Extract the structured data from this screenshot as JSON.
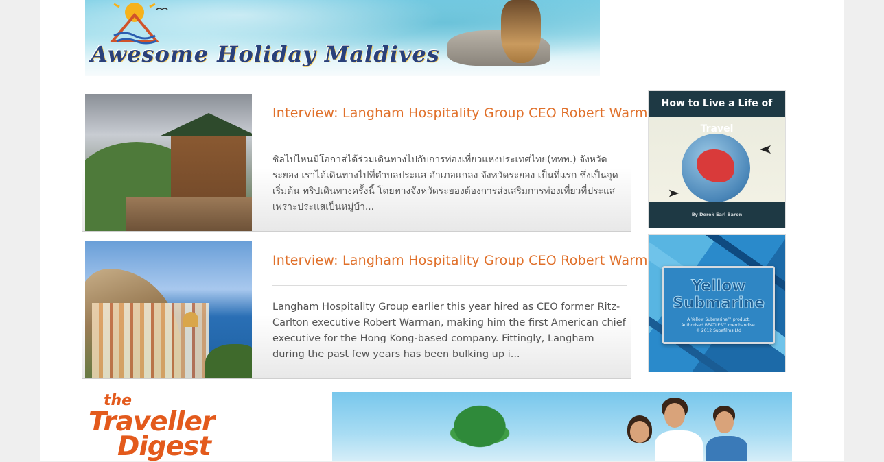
{
  "header": {
    "banner_text": "Awesome Holiday Maldives"
  },
  "articles": [
    {
      "title": "Interview: Langham Hospitality Group CEO Robert Warman",
      "excerpt": "ชิลไปไหนมีโอกาสได้ร่วมเดินทางไปกับการท่องเที่ยวแห่งประเทศไทย(ททท.) จังหวัดระยอง เราได้เดินทางไปที่ตำบลประแส อำเภอแกลง จังหวัดระยอง เป็นที่แรก ซึ่งเป็นจุดเริ่มต้น ทริปเดินทางครั้งนี้ โดยทางจังหวัดระยองต้องการส่งเสริมการท่องเที่ยวที่ประแส เพราะประแสเป็นหมู่บ้า..."
    },
    {
      "title": "Interview: Langham Hospitality Group CEO Robert Warman",
      "excerpt": "Langham Hospitality Group earlier this year hired as CEO former Ritz-Carlton executive Robert Warman, making him the first American chief executive for the Hong Kong-based company. Fittingly, Langham during the past few years has been bulking up i..."
    }
  ],
  "sidebar": {
    "ad1": {
      "heading": "How to Live a Life of Travel",
      "footer": "By Derek Earl Baron"
    },
    "ad2": {
      "title_line1": "Yellow",
      "title_line2": "Submarine",
      "fine_print_1": "A Yellow Submarine™ product.",
      "fine_print_2": "Authorised BEATLES™ merchandise.",
      "fine_print_3": "© 2012 Subafilms Ltd"
    }
  },
  "footer_brand": {
    "the": "the",
    "traveller": "Traveller",
    "digest": "Digest"
  },
  "colors": {
    "title_accent": "#e0702a",
    "brand_orange": "#e35a1c",
    "ad_dark": "#1e3944"
  }
}
